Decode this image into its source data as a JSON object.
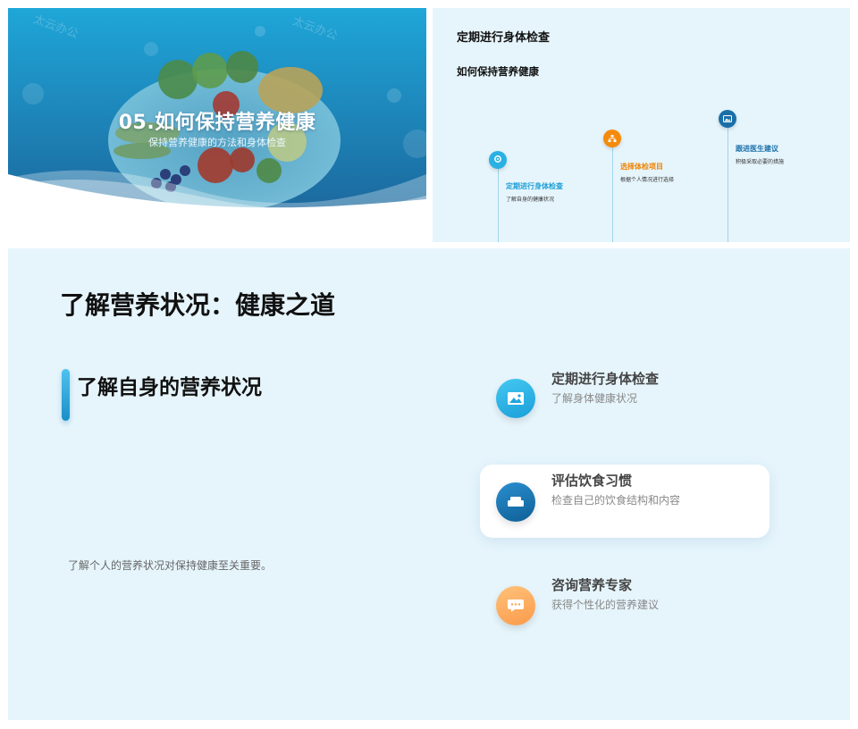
{
  "cover": {
    "title": "05.如何保持营养健康",
    "subtitle": "保持营养健康的方法和身体检查",
    "watermark": "太云办公",
    "colors": {
      "top": "#1fa6d8",
      "bottom": "#1b5f95"
    }
  },
  "timeline_slide": {
    "heading": "定期进行身体检查",
    "subheading": "如何保持营养健康",
    "items": [
      {
        "title": "定期进行身体检查",
        "desc": "了解自身的健康状况",
        "color": "#2ab1e3",
        "icon": "location-pin-icon"
      },
      {
        "title": "选择体检项目",
        "desc": "根据个人情况进行选择",
        "color": "#f58a0b",
        "icon": "hierarchy-icon"
      },
      {
        "title": "跟进医生建议",
        "desc": "积极采取必要的措施",
        "color": "#1a6fa8",
        "icon": "image-icon"
      }
    ]
  },
  "main_slide": {
    "title": "了解营养状况：健康之道",
    "section_title": "了解自身的营养状况",
    "body": "了解个人的营养状况对保持健康至关重要。",
    "features": [
      {
        "title": "定期进行身体检查",
        "desc": "了解身体健康状况",
        "color_from": "#45c8f2",
        "color_to": "#1a9fd9",
        "icon": "image-icon"
      },
      {
        "title": "评估饮食习惯",
        "desc": "检查自己的饮食结构和内容",
        "color_from": "#2a8fcf",
        "color_to": "#0f5f96",
        "icon": "sofa-icon"
      },
      {
        "title": "咨询营养专家",
        "desc": "获得个性化的营养建议",
        "color_from": "#ffc27a",
        "color_to": "#fb9a4b",
        "icon": "chat-bubble-icon"
      }
    ]
  }
}
